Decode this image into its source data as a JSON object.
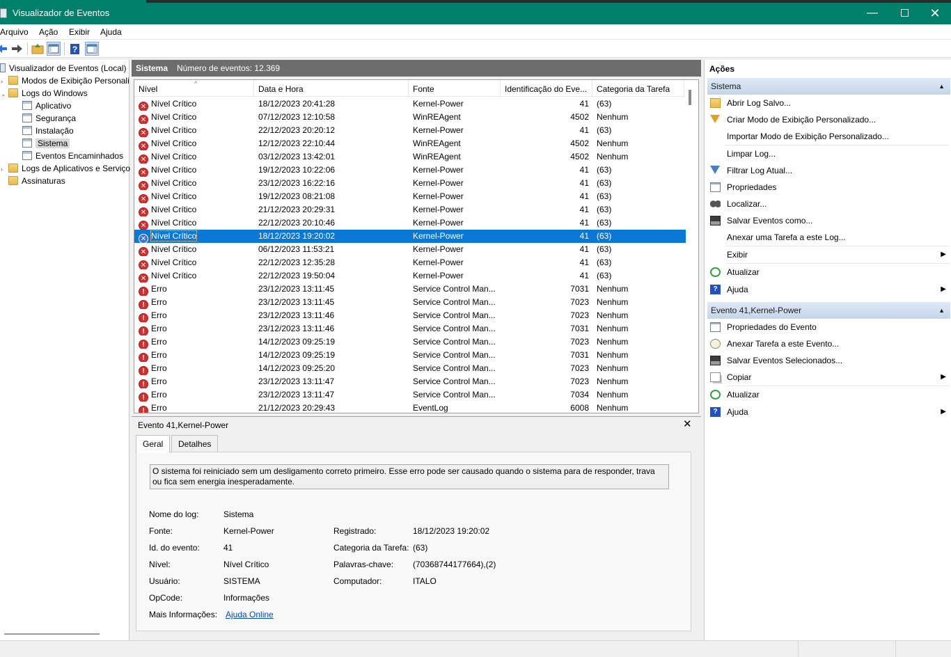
{
  "window": {
    "title": "Visualizador de Eventos"
  },
  "menu": [
    "Arquivo",
    "Ação",
    "Exibir",
    "Ajuda"
  ],
  "tree": {
    "root": "Visualizador de Eventos (Local)",
    "custom_views": "Modos de Exibição Personali",
    "windows_logs": "Logs do Windows",
    "application": "Aplicativo",
    "security": "Segurança",
    "setup": "Instalação",
    "system": "Sistema",
    "forwarded": "Eventos Encaminhados",
    "apps_services": "Logs de Aplicativos e Serviço",
    "subscriptions": "Assinaturas"
  },
  "center": {
    "log_name": "Sistema",
    "event_count": "Número de eventos: 12.369",
    "columns": [
      "Nível",
      "Data e Hora",
      "Fonte",
      "Identificação do Eve...",
      "Categoria da Tarefa"
    ],
    "rows": [
      {
        "level": "Nível Crítico",
        "type": "crit",
        "date": "18/12/2023 20:41:28",
        "source": "Kernel-Power",
        "id": "41",
        "cat": "(63)"
      },
      {
        "level": "Nível Crítico",
        "type": "crit",
        "date": "07/12/2023 12:10:58",
        "source": "WinREAgent",
        "id": "4502",
        "cat": "Nenhum"
      },
      {
        "level": "Nível Crítico",
        "type": "crit",
        "date": "22/12/2023 20:20:12",
        "source": "Kernel-Power",
        "id": "41",
        "cat": "(63)"
      },
      {
        "level": "Nível Crítico",
        "type": "crit",
        "date": "12/12/2023 22:10:44",
        "source": "WinREAgent",
        "id": "4502",
        "cat": "Nenhum"
      },
      {
        "level": "Nível Crítico",
        "type": "crit",
        "date": "03/12/2023 13:42:01",
        "source": "WinREAgent",
        "id": "4502",
        "cat": "Nenhum"
      },
      {
        "level": "Nível Crítico",
        "type": "crit",
        "date": "19/12/2023 10:22:06",
        "source": "Kernel-Power",
        "id": "41",
        "cat": "(63)"
      },
      {
        "level": "Nível Crítico",
        "type": "crit",
        "date": "23/12/2023 16:22:16",
        "source": "Kernel-Power",
        "id": "41",
        "cat": "(63)"
      },
      {
        "level": "Nível Crítico",
        "type": "crit",
        "date": "19/12/2023 08:21:08",
        "source": "Kernel-Power",
        "id": "41",
        "cat": "(63)"
      },
      {
        "level": "Nível Crítico",
        "type": "crit",
        "date": "21/12/2023 20:29:31",
        "source": "Kernel-Power",
        "id": "41",
        "cat": "(63)"
      },
      {
        "level": "Nível Crítico",
        "type": "crit",
        "date": "22/12/2023 20:10:46",
        "source": "Kernel-Power",
        "id": "41",
        "cat": "(63)"
      },
      {
        "level": "Nível Crítico",
        "type": "crit",
        "date": "18/12/2023 19:20:02",
        "source": "Kernel-Power",
        "id": "41",
        "cat": "(63)",
        "selected": true
      },
      {
        "level": "Nível Crítico",
        "type": "crit",
        "date": "06/12/2023 11:53:21",
        "source": "Kernel-Power",
        "id": "41",
        "cat": "(63)"
      },
      {
        "level": "Nível Crítico",
        "type": "crit",
        "date": "22/12/2023 12:35:28",
        "source": "Kernel-Power",
        "id": "41",
        "cat": "(63)"
      },
      {
        "level": "Nível Crítico",
        "type": "crit",
        "date": "22/12/2023 19:50:04",
        "source": "Kernel-Power",
        "id": "41",
        "cat": "(63)"
      },
      {
        "level": "Erro",
        "type": "err",
        "date": "23/12/2023 13:11:45",
        "source": "Service Control Man...",
        "id": "7031",
        "cat": "Nenhum"
      },
      {
        "level": "Erro",
        "type": "err",
        "date": "23/12/2023 13:11:45",
        "source": "Service Control Man...",
        "id": "7023",
        "cat": "Nenhum"
      },
      {
        "level": "Erro",
        "type": "err",
        "date": "23/12/2023 13:11:46",
        "source": "Service Control Man...",
        "id": "7023",
        "cat": "Nenhum"
      },
      {
        "level": "Erro",
        "type": "err",
        "date": "23/12/2023 13:11:46",
        "source": "Service Control Man...",
        "id": "7031",
        "cat": "Nenhum"
      },
      {
        "level": "Erro",
        "type": "err",
        "date": "14/12/2023 09:25:19",
        "source": "Service Control Man...",
        "id": "7023",
        "cat": "Nenhum"
      },
      {
        "level": "Erro",
        "type": "err",
        "date": "14/12/2023 09:25:19",
        "source": "Service Control Man...",
        "id": "7031",
        "cat": "Nenhum"
      },
      {
        "level": "Erro",
        "type": "err",
        "date": "14/12/2023 09:25:20",
        "source": "Service Control Man...",
        "id": "7023",
        "cat": "Nenhum"
      },
      {
        "level": "Erro",
        "type": "err",
        "date": "23/12/2023 13:11:47",
        "source": "Service Control Man...",
        "id": "7023",
        "cat": "Nenhum"
      },
      {
        "level": "Erro",
        "type": "err",
        "date": "23/12/2023 13:11:47",
        "source": "Service Control Man...",
        "id": "7034",
        "cat": "Nenhum"
      },
      {
        "level": "Erro",
        "type": "err",
        "date": "21/12/2023 20:29:43",
        "source": "EventLog",
        "id": "6008",
        "cat": "Nenhum"
      }
    ]
  },
  "detail": {
    "title": "Evento 41,Kernel-Power",
    "close": "✕",
    "tab_general": "Geral",
    "tab_details": "Detalhes",
    "description": "O sistema foi reiniciado sem um desligamento correto primeiro. Esse erro pode ser causado quando o sistema para de responder, trava ou fica sem energia inesperadamente.",
    "log_name_label": "Nome do log:",
    "log_name_value": "Sistema",
    "source_label": "Fonte:",
    "source_value": "Kernel-Power",
    "logged_label": "Registrado:",
    "logged_value": "18/12/2023 19:20:02",
    "event_id_label": "Id. do evento:",
    "event_id_value": "41",
    "task_cat_label": "Categoria da Tarefa:",
    "task_cat_value": "(63)",
    "level_label": "Nível:",
    "level_value": "Nível Crítico",
    "keywords_label": "Palavras-chave:",
    "keywords_value": "(70368744177664),(2)",
    "user_label": "Usuário:",
    "user_value": "SISTEMA",
    "computer_label": "Computador:",
    "computer_value": "ITALO",
    "opcode_label": "OpCode:",
    "opcode_value": "Informações",
    "more_info_label": "Mais Informações:",
    "more_info_link": "Ajuda Online"
  },
  "actions": {
    "title": "Ações",
    "section1": "Sistema",
    "open_saved": "Abrir Log Salvo...",
    "create_view": "Criar Modo de Exibição Personalizado...",
    "import_view": "Importar Modo de Exibição Personalizado...",
    "clear_log": "Limpar Log...",
    "filter_log": "Filtrar Log Atual...",
    "properties": "Propriedades",
    "find": "Localizar...",
    "save_as": "Salvar Eventos como...",
    "attach_log": "Anexar uma Tarefa a este Log...",
    "view": "Exibir",
    "refresh1": "Atualizar",
    "help1": "Ajuda",
    "section2": "Evento 41,Kernel-Power",
    "event_props": "Propriedades do Evento",
    "attach_event": "Anexar Tarefa a este Evento...",
    "save_selected": "Salvar Eventos Selecionados...",
    "copy": "Copiar",
    "refresh2": "Atualizar",
    "help2": "Ajuda"
  }
}
